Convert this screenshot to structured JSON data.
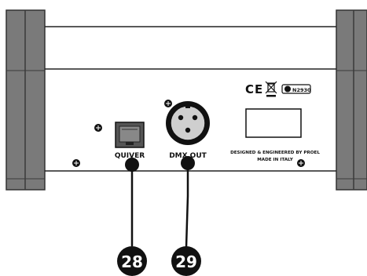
{
  "colors": {
    "end_cap": "#7a7a7a",
    "end_cap_dark": "#3a3a3a",
    "panel_line": "#222222",
    "callout": "#111111",
    "badge_text": "#ffffff"
  },
  "panel": {
    "ports": {
      "quiver_label": "QUIVER",
      "dmx_label": "DMX OUT"
    },
    "certification": {
      "ce_mark": "CE",
      "weee_icon": "weee-bin-icon",
      "code": "N2930"
    },
    "credits": {
      "line1": "DESIGNED & ENGINEERED BY PROEL",
      "line2": "MADE IN ITALY"
    }
  },
  "callouts": [
    {
      "number": "28",
      "target": "quiver-port"
    },
    {
      "number": "29",
      "target": "dmx-out-connector"
    }
  ]
}
